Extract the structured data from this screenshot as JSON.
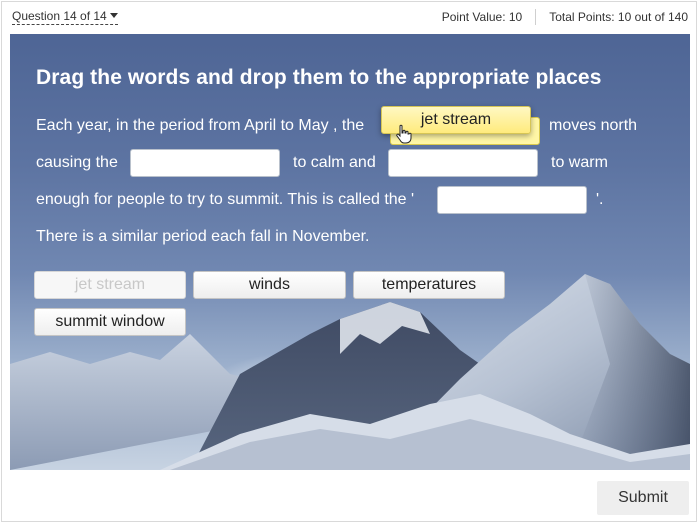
{
  "header": {
    "question_selector": "Question 14 of 14",
    "point_value": "Point Value: 10",
    "total_points": "Total Points: 10 out of 140"
  },
  "question": {
    "title": "Drag the words and drop them to the appropriate places",
    "line1_a": "Each year, in the period from April to May , the",
    "line1_b": "moves north",
    "line2_a": "causing the",
    "line2_b": "to calm and",
    "line2_c": "to warm",
    "line3_a": "enough for people to try to summit. This is called the '",
    "line3_b": "'.",
    "line4": "There is a similar period each fall in November."
  },
  "drag_state": {
    "dragging_word": "jet stream"
  },
  "word_bank": [
    {
      "label": "jet stream",
      "used": true
    },
    {
      "label": "winds",
      "used": false
    },
    {
      "label": "temperatures",
      "used": false
    },
    {
      "label": "summit window",
      "used": false
    }
  ],
  "footer": {
    "submit_label": "Submit"
  },
  "icons": {
    "cursor": "hand-pointer-icon",
    "dropdown": "caret-down-icon"
  },
  "colors": {
    "drop_highlight": "#fff6a6",
    "dragging_chip": "#ffeb7d",
    "panel_sky": "#5d74a2"
  }
}
